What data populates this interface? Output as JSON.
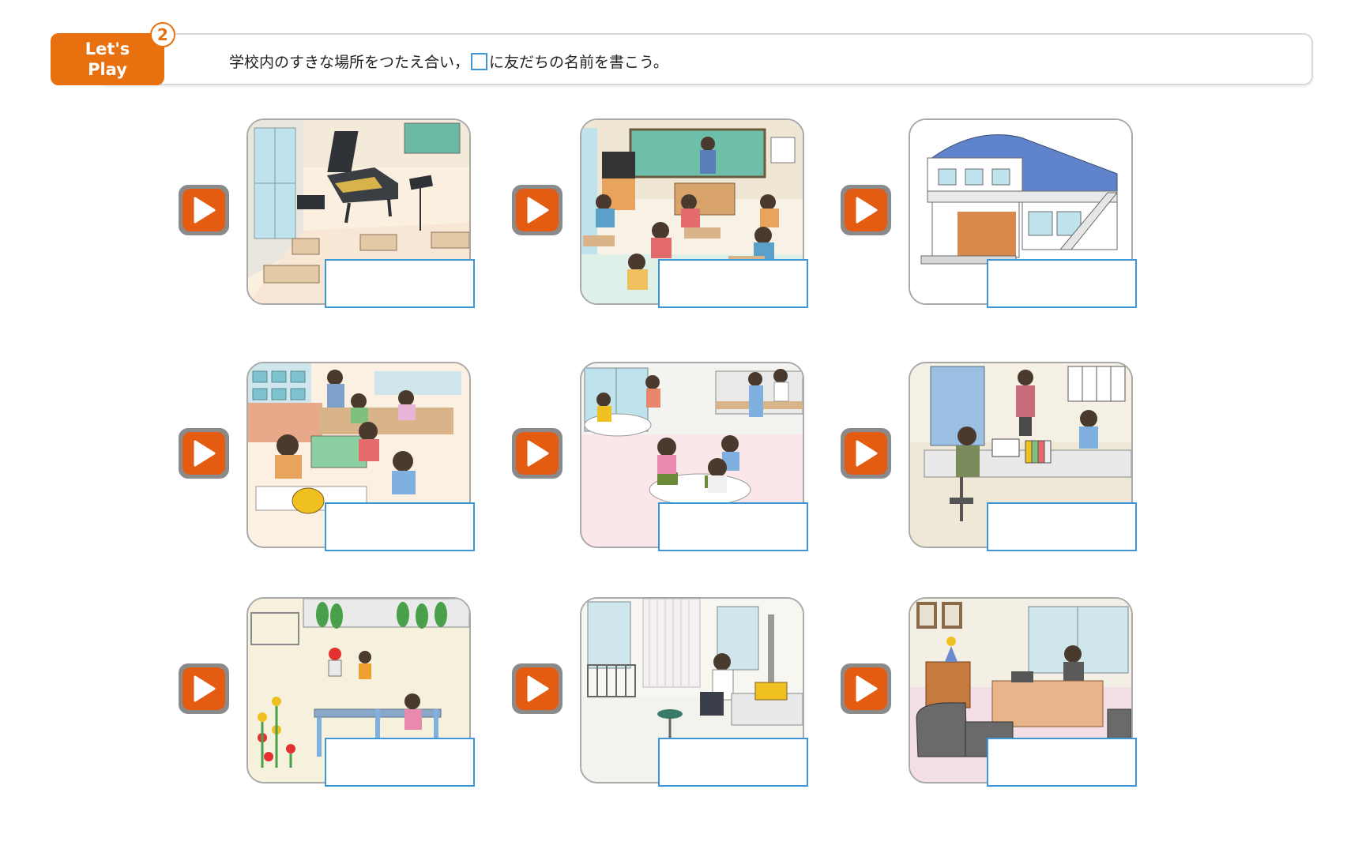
{
  "header": {
    "badge_line1": "Let's",
    "badge_line2": "Play",
    "badge_number": "2",
    "instruction_before": "学校内のすきな場所をつたえ合い，",
    "instruction_after": "に友だちの名前を書こう。"
  },
  "colors": {
    "badge": "#e8700f",
    "play_button": "#e45c12",
    "name_box_border": "#3c96d8",
    "frame_border": "#a9a9a9"
  },
  "scenes": [
    {
      "name": "music-room",
      "icon": "play-icon"
    },
    {
      "name": "classroom",
      "icon": "play-icon"
    },
    {
      "name": "gym",
      "icon": "play-icon"
    },
    {
      "name": "arts-and-crafts-room",
      "icon": "play-icon"
    },
    {
      "name": "lunch-room",
      "icon": "play-icon"
    },
    {
      "name": "teachers-office",
      "icon": "play-icon"
    },
    {
      "name": "school-ground",
      "icon": "play-icon"
    },
    {
      "name": "nurses-office",
      "icon": "play-icon"
    },
    {
      "name": "principals-office",
      "icon": "play-icon"
    }
  ]
}
